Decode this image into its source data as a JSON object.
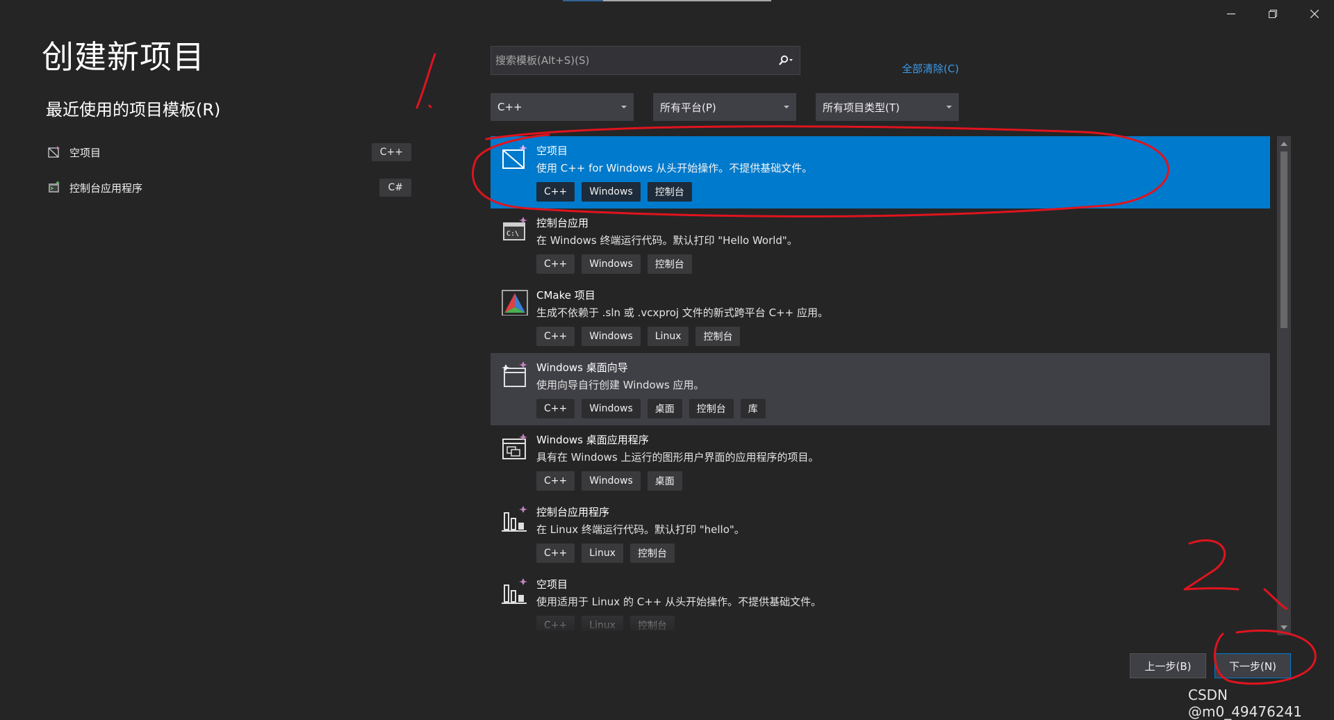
{
  "window": {
    "controls": [
      "minimize-icon",
      "restore-icon",
      "close-icon"
    ]
  },
  "page": {
    "title": "创建新项目"
  },
  "recent": {
    "title": "最近使用的项目模板(R)",
    "items": [
      {
        "label": "空项目",
        "tag": "C++",
        "icon": "empty-project-icon"
      },
      {
        "label": "控制台应用程序",
        "tag": "C#",
        "icon": "console-app-icon"
      }
    ]
  },
  "search": {
    "placeholder": "搜索模板(Alt+S)(S)",
    "value": "",
    "icon": "search-icon"
  },
  "filters": {
    "clear_all": "全部清除(C)",
    "language": "C++",
    "platform": "所有平台(P)",
    "project_type": "所有项目类型(T)"
  },
  "templates": [
    {
      "name": "空项目",
      "desc": "使用 C++ for Windows 从头开始操作。不提供基础文件。",
      "tags": [
        "C++",
        "Windows",
        "控制台"
      ],
      "state": "selected",
      "icon": "empty-project-icon"
    },
    {
      "name": "控制台应用",
      "desc": "在 Windows 终端运行代码。默认打印 \"Hello World\"。",
      "tags": [
        "C++",
        "Windows",
        "控制台"
      ],
      "state": "normal",
      "icon": "console-icon"
    },
    {
      "name": "CMake 项目",
      "desc": "生成不依赖于 .sln 或 .vcxproj 文件的新式跨平台 C++ 应用。",
      "tags": [
        "C++",
        "Windows",
        "Linux",
        "控制台"
      ],
      "state": "normal",
      "icon": "cmake-icon"
    },
    {
      "name": "Windows 桌面向导",
      "desc": "使用向导自行创建 Windows 应用。",
      "tags": [
        "C++",
        "Windows",
        "桌面",
        "控制台",
        "库"
      ],
      "state": "hover",
      "icon": "desktop-wizard-icon"
    },
    {
      "name": "Windows 桌面应用程序",
      "desc": "具有在 Windows 上运行的图形用户界面的应用程序的项目。",
      "tags": [
        "C++",
        "Windows",
        "桌面"
      ],
      "state": "normal",
      "icon": "desktop-app-icon"
    },
    {
      "name": "控制台应用程序",
      "desc": "在 Linux 终端运行代码。默认打印 \"hello\"。",
      "tags": [
        "C++",
        "Linux",
        "控制台"
      ],
      "state": "normal",
      "icon": "linux-console-icon"
    },
    {
      "name": "空项目",
      "desc": "使用适用于 Linux 的 C++ 从头开始操作。不提供基础文件。",
      "tags": [
        "C++",
        "Linux",
        "控制台"
      ],
      "state": "normal",
      "icon": "linux-empty-icon"
    }
  ],
  "buttons": {
    "back": "上一步(B)",
    "next": "下一步(N)"
  },
  "watermark": "CSDN @m0_49476241",
  "colors": {
    "background": "#252526",
    "accent": "#007acc",
    "annotation": "#e0141e"
  }
}
